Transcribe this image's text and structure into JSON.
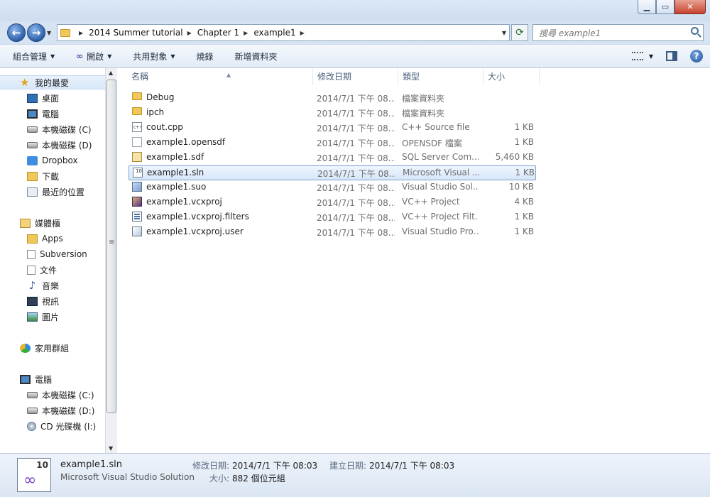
{
  "address": {
    "crumbs": [
      "2014 Summer tutorial",
      "Chapter 1",
      "example1"
    ]
  },
  "search": {
    "placeholder": "搜尋 example1"
  },
  "toolbar": {
    "organize": "組合管理",
    "open": "開啟",
    "share": "共用對象",
    "burn": "燒錄",
    "new_folder": "新增資料夾"
  },
  "nav": {
    "favorites_header": "我的最愛",
    "favorites": [
      "桌面",
      "電腦",
      "本機磁碟 (C)",
      "本機磁碟 (D)",
      "Dropbox",
      "下載",
      "最近的位置"
    ],
    "libraries_header": "媒體櫃",
    "libraries": [
      "Apps",
      "Subversion",
      "文件",
      "音樂",
      "視訊",
      "圖片"
    ],
    "homegroup": "家用群組",
    "computer_header": "電腦",
    "computer": [
      "本機磁碟 (C:)",
      "本機磁碟 (D:)",
      "CD 光碟機 (I:)"
    ]
  },
  "columns": {
    "name": "名稱",
    "date": "修改日期",
    "type": "類型",
    "size": "大小"
  },
  "files": [
    {
      "name": "Debug",
      "date": "2014/7/1 下午 08...",
      "type": "檔案資料夾",
      "size": "",
      "icon": "folder-icon"
    },
    {
      "name": "ipch",
      "date": "2014/7/1 下午 08...",
      "type": "檔案資料夾",
      "size": "",
      "icon": "folder-icon"
    },
    {
      "name": "cout.cpp",
      "date": "2014/7/1 下午 08...",
      "type": "C++ Source file",
      "size": "1 KB",
      "icon": "cpp-file-icon"
    },
    {
      "name": "example1.opensdf",
      "date": "2014/7/1 下午 08...",
      "type": "OPENSDF 檔案",
      "size": "1 KB",
      "icon": "blank-file-icon"
    },
    {
      "name": "example1.sdf",
      "date": "2014/7/1 下午 08...",
      "type": "SQL Server Com...",
      "size": "5,460 KB",
      "icon": "sdf-file-icon"
    },
    {
      "name": "example1.sln",
      "date": "2014/7/1 下午 08...",
      "type": "Microsoft Visual ...",
      "size": "1 KB",
      "icon": "sln-file-icon",
      "selected": true
    },
    {
      "name": "example1.suo",
      "date": "2014/7/1 下午 08...",
      "type": "Visual Studio Sol...",
      "size": "10 KB",
      "icon": "suo-file-icon"
    },
    {
      "name": "example1.vcxproj",
      "date": "2014/7/1 下午 08...",
      "type": "VC++ Project",
      "size": "4 KB",
      "icon": "vcxproj-file-icon"
    },
    {
      "name": "example1.vcxproj.filters",
      "date": "2014/7/1 下午 08...",
      "type": "VC++ Project Filt...",
      "size": "1 KB",
      "icon": "filters-file-icon"
    },
    {
      "name": "example1.vcxproj.user",
      "date": "2014/7/1 下午 08...",
      "type": "Visual Studio Pro...",
      "size": "1 KB",
      "icon": "user-file-icon"
    }
  ],
  "details": {
    "icon_badge": "10",
    "filename": "example1.sln",
    "filetype": "Microsoft Visual Studio Solution",
    "modified_label": "修改日期:",
    "modified_value": "2014/7/1 下午 08:03",
    "created_label": "建立日期:",
    "created_value": "2014/7/1 下午 08:03",
    "size_label": "大小:",
    "size_value": "882 個位元組"
  }
}
